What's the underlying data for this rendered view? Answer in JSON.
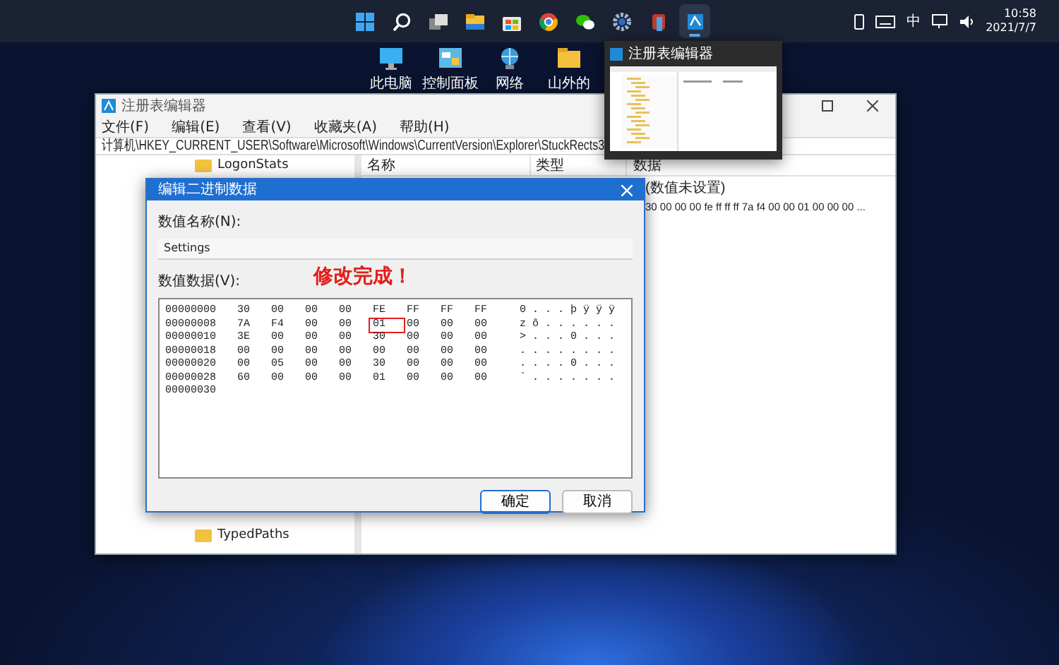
{
  "taskbar": {
    "apps": [
      {
        "kind": "start",
        "selected": false
      },
      {
        "kind": "search",
        "selected": false
      },
      {
        "kind": "taskview",
        "selected": false
      },
      {
        "kind": "folder",
        "selected": false
      },
      {
        "kind": "store",
        "selected": false
      },
      {
        "kind": "browser",
        "selected": false
      },
      {
        "kind": "chat",
        "selected": false
      },
      {
        "kind": "gear",
        "selected": false
      },
      {
        "kind": "app",
        "selected": false
      },
      {
        "kind": "regedit",
        "selected": true
      }
    ],
    "tray": {
      "ime": "中",
      "time": "10:58",
      "date": "2021/7/7"
    }
  },
  "desktop_icons": [
    {
      "kind": "monitor",
      "label": "此电脑"
    },
    {
      "kind": "panel",
      "label": "控制面板"
    },
    {
      "kind": "globe",
      "label": "网络"
    },
    {
      "kind": "folder",
      "label": "山外的"
    }
  ],
  "thumbnail": {
    "title": "注册表编辑器"
  },
  "regedit": {
    "title": "注册表编辑器",
    "menu": [
      "文件(F)",
      "编辑(E)",
      "查看(V)",
      "收藏夹(A)",
      "帮助(H)"
    ],
    "address": "计算机\\HKEY_CURRENT_USER\\Software\\Microsoft\\Windows\\CurrentVersion\\Explorer\\StuckRects3",
    "tree": [
      {
        "label": "LogonStats"
      },
      {
        "label": "TypedPaths"
      }
    ],
    "columns": [
      "名称",
      "类型",
      "数据"
    ],
    "data_column": [
      "(数值未设置)",
      "30 00 00 00 fe ff ff ff 7a f4 00 00 01 00 00 00 ..."
    ]
  },
  "dialog": {
    "title": "编辑二进制数据",
    "name_label": "数值名称(N):",
    "name_value": "Settings",
    "data_label": "数值数据(V):",
    "hex_rows": [
      {
        "address": "00000000",
        "bytes": [
          "30",
          "00",
          "00",
          "00",
          "FE",
          "FF",
          "FF",
          "FF"
        ],
        "marked": [
          false,
          false,
          false,
          false,
          false,
          false,
          false,
          false
        ],
        "ascii": "0 . . . þ ÿ ÿ ÿ"
      },
      {
        "address": "00000008",
        "bytes": [
          "7A",
          "F4",
          "00",
          "00",
          "01",
          "00",
          "00",
          "00"
        ],
        "marked": [
          false,
          false,
          false,
          false,
          true,
          false,
          false,
          false
        ],
        "ascii": "z ô . . . . . ."
      },
      {
        "address": "00000010",
        "bytes": [
          "3E",
          "00",
          "00",
          "00",
          "30",
          "00",
          "00",
          "00"
        ],
        "marked": [
          false,
          false,
          false,
          false,
          false,
          false,
          false,
          false
        ],
        "ascii": "> . . . 0 . . ."
      },
      {
        "address": "00000018",
        "bytes": [
          "00",
          "00",
          "00",
          "00",
          "00",
          "00",
          "00",
          "00"
        ],
        "marked": [
          false,
          false,
          false,
          false,
          false,
          false,
          false,
          false
        ],
        "ascii": ". . . . . . . ."
      },
      {
        "address": "00000020",
        "bytes": [
          "00",
          "05",
          "00",
          "00",
          "30",
          "00",
          "00",
          "00"
        ],
        "marked": [
          false,
          false,
          false,
          false,
          false,
          false,
          false,
          false
        ],
        "ascii": ". . . . 0 . . ."
      },
      {
        "address": "00000028",
        "bytes": [
          "60",
          "00",
          "00",
          "00",
          "01",
          "00",
          "00",
          "00"
        ],
        "marked": [
          false,
          false,
          false,
          false,
          false,
          false,
          false,
          false
        ],
        "ascii": "` . . . . . . ."
      },
      {
        "address": "00000030"
      }
    ],
    "annotation": "修改完成！",
    "buttons": [
      {
        "label": "确定",
        "default": true
      },
      {
        "label": "取消",
        "default": false
      }
    ]
  }
}
